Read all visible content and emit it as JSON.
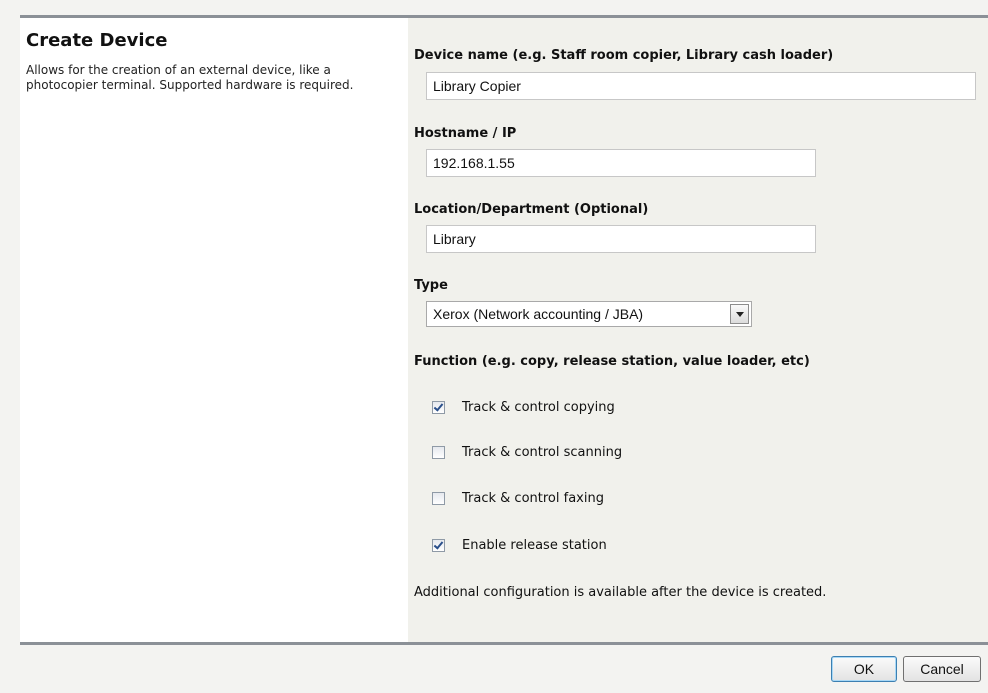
{
  "header": {
    "title": "Create Device",
    "description": "Allows for the creation of an external device, like a photocopier terminal. Supported hardware is required."
  },
  "form": {
    "device_name": {
      "label": "Device name (e.g. Staff room copier, Library cash loader)",
      "value": "Library Copier"
    },
    "hostname": {
      "label": "Hostname / IP",
      "value": "192.168.1.55"
    },
    "location": {
      "label": "Location/Department (Optional)",
      "value": "Library"
    },
    "type": {
      "label": "Type",
      "selected": "Xerox (Network accounting / JBA)"
    },
    "function": {
      "label": "Function (e.g. copy, release station, value loader, etc)",
      "options": [
        {
          "label": "Track & control copying",
          "checked": true
        },
        {
          "label": "Track & control scanning",
          "checked": false
        },
        {
          "label": "Track & control faxing",
          "checked": false
        },
        {
          "label": "Enable release station",
          "checked": true
        }
      ]
    },
    "note": "Additional configuration is available after the device is created."
  },
  "buttons": {
    "ok_label": "OK",
    "cancel_label": "Cancel"
  },
  "colors": {
    "rule": "#8b9097",
    "form_background": "#f1f1ec",
    "ok_border": "#3c7fb1"
  }
}
